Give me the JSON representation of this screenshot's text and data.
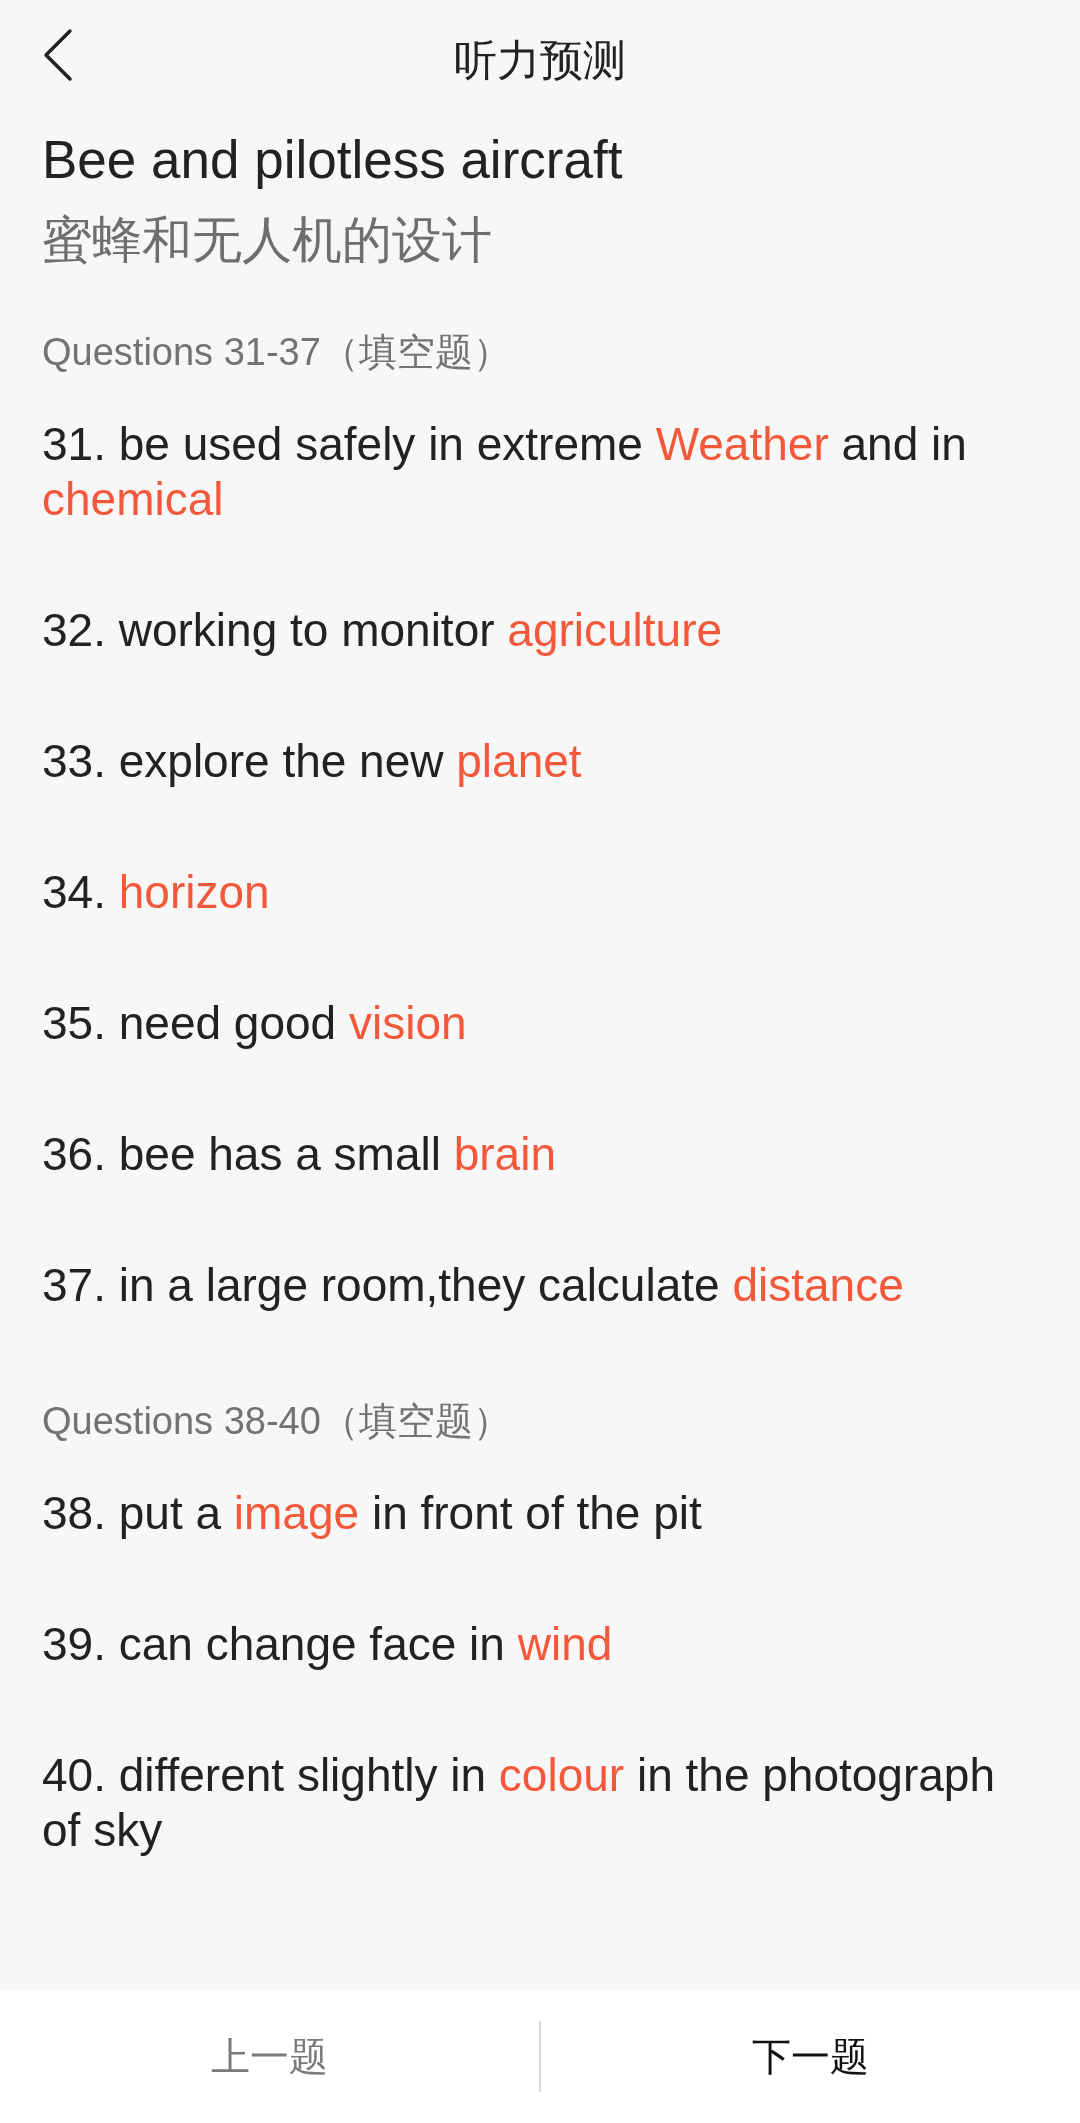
{
  "header": {
    "title": "听力预测"
  },
  "article": {
    "title": "Bee and pilotless aircraft",
    "subtitle": "蜜蜂和无人机的设计"
  },
  "sections": [
    {
      "heading": "Questions 31-37（填空题）",
      "questions": [
        {
          "segments": [
            {
              "kind": "text",
              "text": "31. be used safely in extreme "
            },
            {
              "kind": "answer",
              "text": "Weather"
            },
            {
              "kind": "text",
              "text": " and in "
            },
            {
              "kind": "answer",
              "text": "chemical"
            }
          ]
        },
        {
          "segments": [
            {
              "kind": "text",
              "text": "32. working to monitor "
            },
            {
              "kind": "answer",
              "text": "agriculture"
            }
          ]
        },
        {
          "segments": [
            {
              "kind": "text",
              "text": "33. explore the new "
            },
            {
              "kind": "answer",
              "text": "planet"
            }
          ]
        },
        {
          "segments": [
            {
              "kind": "text",
              "text": "34. "
            },
            {
              "kind": "answer",
              "text": "horizon"
            }
          ]
        },
        {
          "segments": [
            {
              "kind": "text",
              "text": "35. need good "
            },
            {
              "kind": "answer",
              "text": "vision"
            }
          ]
        },
        {
          "segments": [
            {
              "kind": "text",
              "text": "36. bee has a small "
            },
            {
              "kind": "answer",
              "text": "brain"
            }
          ]
        },
        {
          "segments": [
            {
              "kind": "text",
              "text": "37. in a large room,they calculate "
            },
            {
              "kind": "answer",
              "text": "distance"
            }
          ]
        }
      ]
    },
    {
      "heading": "Questions 38-40（填空题）",
      "questions": [
        {
          "segments": [
            {
              "kind": "text",
              "text": "38. put a "
            },
            {
              "kind": "answer",
              "text": "image"
            },
            {
              "kind": "text",
              "text": " in front of the pit"
            }
          ]
        },
        {
          "segments": [
            {
              "kind": "text",
              "text": "39. can change face in "
            },
            {
              "kind": "answer",
              "text": "wind"
            }
          ]
        },
        {
          "segments": [
            {
              "kind": "text",
              "text": "40. different slightly in "
            },
            {
              "kind": "answer",
              "text": "colour"
            },
            {
              "kind": "text",
              "text": " in the photograph of sky"
            }
          ]
        }
      ]
    }
  ],
  "footer": {
    "buttons": [
      {
        "label": "上一题",
        "disabled": true
      },
      {
        "label": "下一题",
        "disabled": false
      }
    ]
  }
}
